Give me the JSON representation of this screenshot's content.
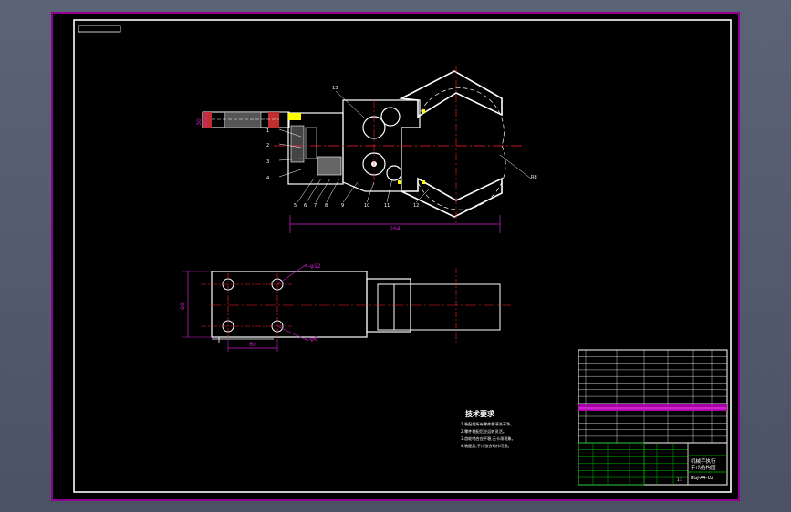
{
  "drawing": {
    "dim_top_width": "264",
    "dim_left_height": "30",
    "dim_small_left": "30",
    "leader_right": "R8",
    "dim_plan_height": "80",
    "dim_plan_bottom": "60",
    "hole_top_label": "4-φ12",
    "hole_bottom_label": "4-φ6",
    "part_numbers": [
      "1",
      "2",
      "3",
      "4",
      "5",
      "6",
      "7",
      "8",
      "9",
      "10",
      "11",
      "12",
      "13",
      "14",
      "15"
    ]
  },
  "notes": {
    "title": "技术要求",
    "items": [
      "1.装配前所有零件需清洗干净。",
      "2.零件装配后应运转灵活。",
      "3.齿轮啮合应平稳,无卡滞现象。",
      "4.装配后,手爪张合动作可靠。"
    ]
  },
  "title_block": {
    "drawing_title": "机械手执行",
    "drawing_subtitle": "手爪结构图",
    "drawing_number": "BGJ-A4-02",
    "scale": "1:1"
  },
  "colors": {
    "sheet": "#000000",
    "frame_outer": "#c000c0",
    "line": "#ffffff",
    "center": "#ff2020",
    "dim": "#d020d0",
    "yellow": "#ffff00",
    "green": "#00c000"
  }
}
